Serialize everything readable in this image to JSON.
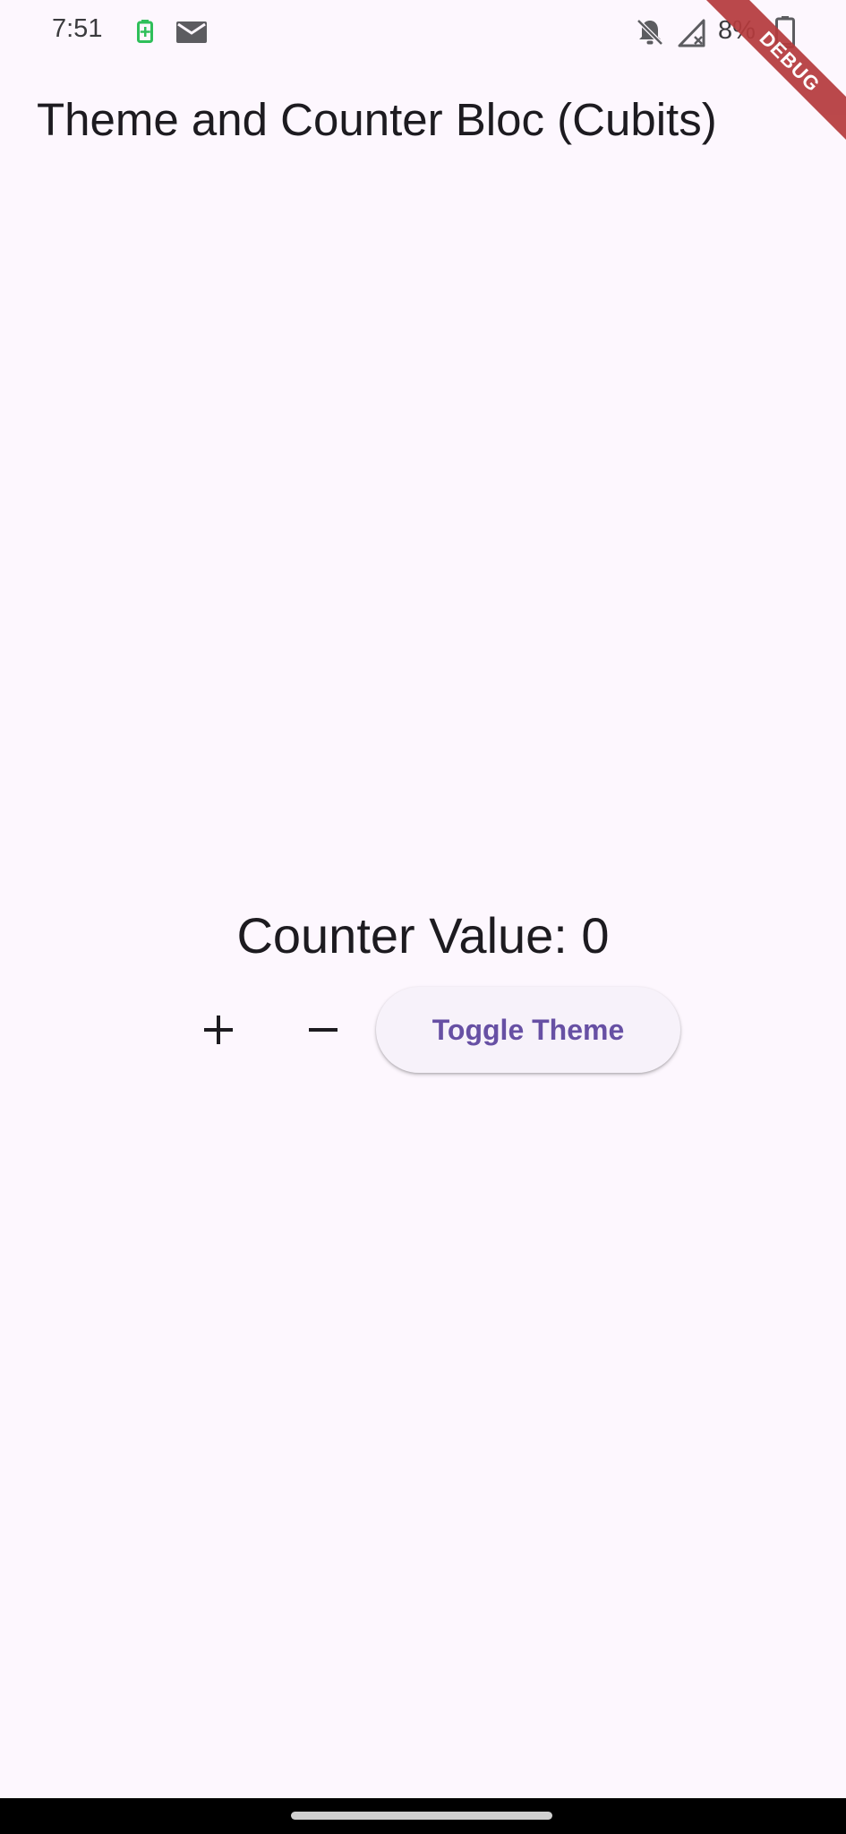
{
  "status_bar": {
    "time": "7:51",
    "battery_percent": "8%",
    "icons": [
      "battery-saver-icon",
      "mail-icon",
      "bell-off-icon",
      "signal-icon",
      "battery-icon"
    ]
  },
  "debug_banner": {
    "label": "DEBUG",
    "color": "#b53a3c"
  },
  "app_bar": {
    "title": "Theme and Counter Bloc (Cubits)"
  },
  "counter": {
    "label": "Counter Value: 0"
  },
  "actions": {
    "increment_icon": "add-icon",
    "decrement_icon": "remove-icon",
    "toggle_label": "Toggle Theme"
  },
  "colors": {
    "background": "#fdf7fe",
    "primary": "#6750a4",
    "text": "#1d1b20"
  }
}
